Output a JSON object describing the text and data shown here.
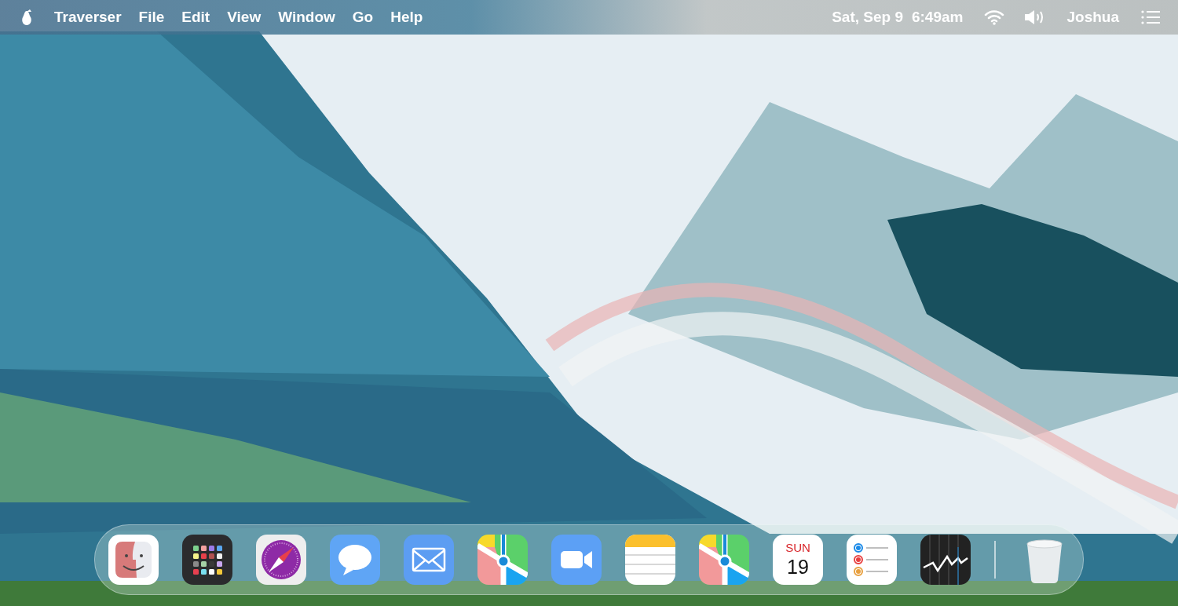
{
  "menu_bar": {
    "app_name": "Traverser",
    "menus": [
      "File",
      "Edit",
      "View",
      "Window",
      "Go",
      "Help"
    ],
    "date": "Sat, Sep 9",
    "time": "6:49am",
    "user": "Joshua"
  },
  "dock": {
    "apps": [
      {
        "kind": "finder"
      },
      {
        "kind": "launcher"
      },
      {
        "kind": "compass"
      },
      {
        "kind": "messages"
      },
      {
        "kind": "mail"
      },
      {
        "kind": "maps"
      },
      {
        "kind": "video"
      },
      {
        "kind": "notes"
      },
      {
        "kind": "maps"
      },
      {
        "kind": "calendar",
        "weekday": "SUN",
        "day": "19"
      },
      {
        "kind": "reminders"
      },
      {
        "kind": "stocks"
      },
      {
        "kind": "separator"
      },
      {
        "kind": "trash"
      }
    ]
  }
}
